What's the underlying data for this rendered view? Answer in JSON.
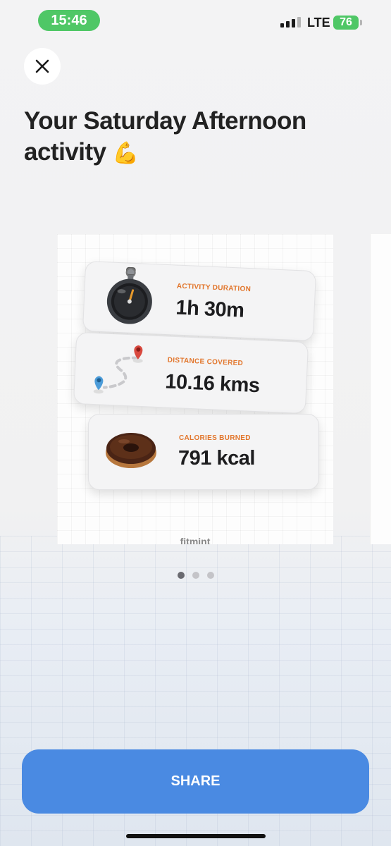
{
  "status_bar": {
    "time": "15:46",
    "network": "LTE",
    "battery": "76"
  },
  "header": {
    "title": "Your Saturday Afternoon activity",
    "title_emoji": "💪"
  },
  "card": {
    "stats": [
      {
        "label": "ACTIVITY DURATION",
        "value": "1h 30m",
        "icon": "stopwatch-icon"
      },
      {
        "label": "DISTANCE COVERED",
        "value": "10.16 kms",
        "icon": "route-icon"
      },
      {
        "label": "CALORIES BURNED",
        "value": "791 kcal",
        "icon": "donut-icon"
      }
    ],
    "brand": "fitmint"
  },
  "pager": {
    "count": 3,
    "active": 1
  },
  "actions": {
    "share_label": "SHARE"
  },
  "colors": {
    "accent": "#4a8ae2",
    "label_orange": "#e2762c",
    "status_green": "#4fc766"
  }
}
